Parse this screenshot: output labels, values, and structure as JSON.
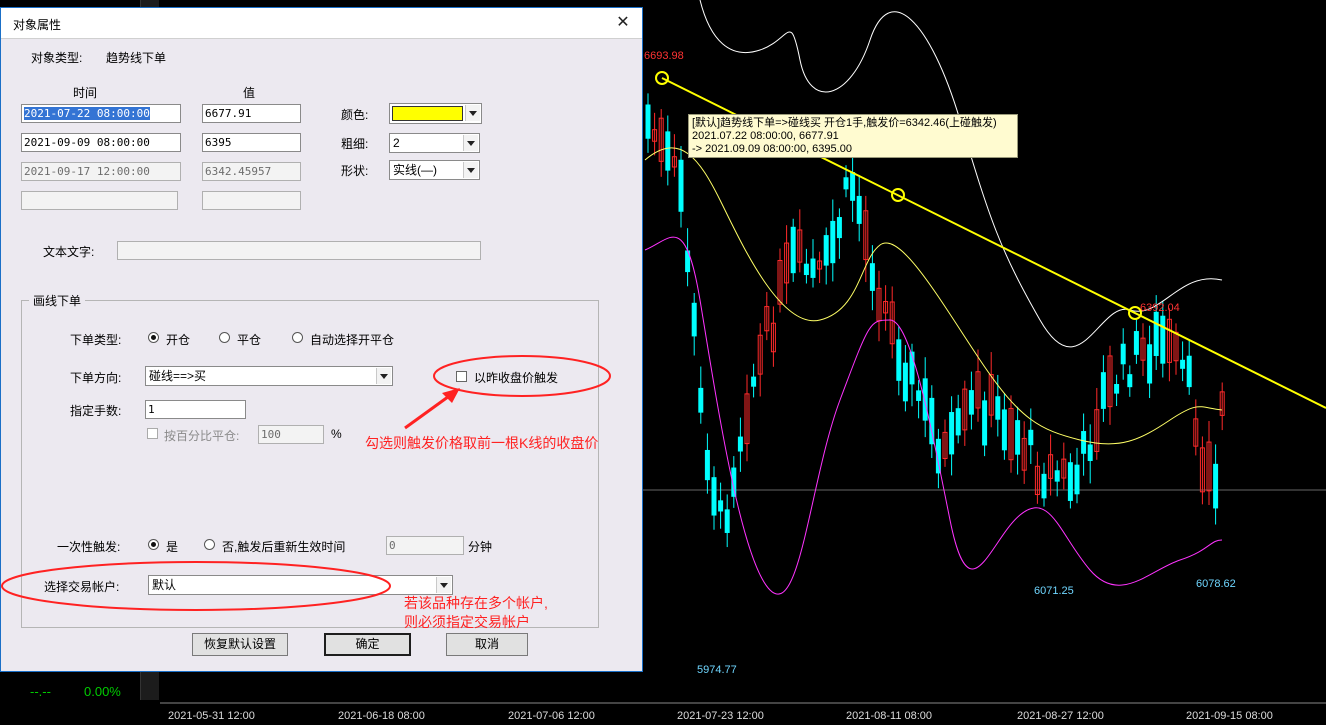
{
  "dialog": {
    "title": "对象属性",
    "object_type_label": "对象类型:",
    "object_type_value": "趋势线下单",
    "col_time": "时间",
    "col_value": "值",
    "rows": [
      {
        "time": "2021-07-22 08:00:00",
        "value": "6677.91"
      },
      {
        "time": "2021-09-09 08:00:00",
        "value": "6395"
      },
      {
        "time": "2021-09-17 12:00:00",
        "value": "6342.45957"
      }
    ],
    "color_label": "颜色:",
    "color_value": "#ffff00",
    "width_label": "粗细:",
    "width_value": "2",
    "shape_label": "形状:",
    "shape_value": "实线(—)",
    "text_label": "文本文字:",
    "group_title": "画线下单",
    "order_type_label": "下单类型:",
    "order_type_options": [
      "开仓",
      "平仓",
      "自动选择开平仓"
    ],
    "direction_label": "下单方向:",
    "direction_value": "碰线==>买",
    "prev_close_label": "以昨收盘价触发",
    "lots_label": "指定手数:",
    "lots_value": "1",
    "percent_label": "按百分比平仓:",
    "percent_value": "100",
    "percent_unit": "%",
    "one_time_label": "一次性触发:",
    "one_time_yes": "是",
    "one_time_no": "否,触发后重新生效时间",
    "retrigger_value": "0",
    "minute_unit": "分钟",
    "account_label": "选择交易帐户:",
    "account_value": "默认",
    "restore_button": "恢复默认设置",
    "ok_button": "确定",
    "cancel_button": "取消"
  },
  "annotations": {
    "prev_close_note": "勾选则触发价格取前一根K线的收盘价",
    "account_note_1": "若该品种存在多个帐户,",
    "account_note_2": "则必须指定交易帐户"
  },
  "chart": {
    "price_top": "6693.98",
    "trendline_tooltip": [
      "[默认]趋势线下单=>碰线买 开仓1手,触发价=6342.46(上碰触发)",
      "2021.07.22 08:00:00, 6677.91",
      "-> 2021.09.09 08:00:00, 6395.00"
    ],
    "touch_price": "6392.04",
    "low_1": "5974.77",
    "low_2": "6071.25",
    "low_3": "6078.62",
    "x_dates": [
      "2021-05-31 12:00",
      "2021-06-18 08:00",
      "2021-07-06 12:00",
      "2021-07-23 12:00",
      "2021-08-11 08:00",
      "2021-08-27 12:00",
      "2021-09-15 08:00"
    ],
    "colors": {
      "up": "#ff2a2a",
      "down": "#00ffff",
      "trendline": "#ffff00",
      "mid_band": "#ffff66",
      "upper_band": "#ffffff",
      "lower_band": "#ff33ff"
    }
  },
  "left_panel": {
    "value_1": "--.--",
    "value_2": "0.00%"
  }
}
